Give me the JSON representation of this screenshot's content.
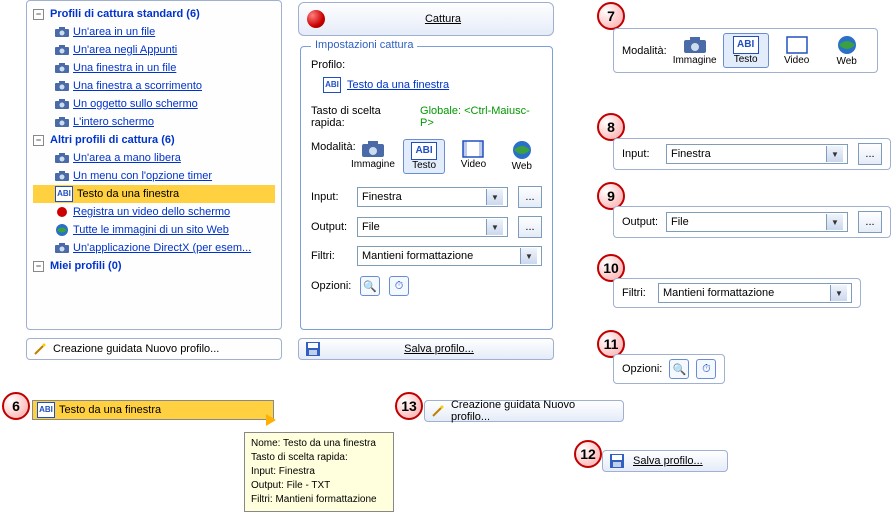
{
  "tree": {
    "header1": "Profili di cattura standard (6)",
    "items1": [
      "Un'area in un file",
      "Un'area negli Appunti",
      "Una finestra in un file",
      "Una finestra a scorrimento",
      "Un oggetto sullo schermo",
      "L'intero schermo"
    ],
    "header2": "Altri profili di cattura (6)",
    "items2": [
      "Un'area a mano libera",
      "Un menu con l'opzione timer",
      "Testo da una finestra",
      "Registra un video dello schermo",
      "Tutte le immagini di un sito Web",
      "Un'applicazione DirectX (per esem..."
    ],
    "header3": "Miei profili (0)"
  },
  "wizard": "Creazione guidata Nuovo profilo...",
  "capture": "Cattura",
  "settings": {
    "title": "Impostazioni cattura",
    "profile_lbl": "Profilo:",
    "profile_name": "Testo da una finestra",
    "hotkey_lbl": "Tasto di scelta rapida:",
    "hotkey_val": "Globale: <Ctrl-Maiusc-P>",
    "mode_lbl": "Modalità:",
    "modes": {
      "img": "Immagine",
      "txt": "Testo",
      "vid": "Video",
      "web": "Web"
    },
    "input_lbl": "Input:",
    "input_val": "Finestra",
    "output_lbl": "Output:",
    "output_val": "File",
    "filter_lbl": "Filtri:",
    "filter_val": "Mantieni formattazione",
    "options_lbl": "Opzioni:"
  },
  "save_profile": "Salva profilo...",
  "callouts": {
    "n6": "6",
    "n7": "7",
    "n8": "8",
    "n9": "9",
    "n10": "10",
    "n11": "11",
    "n12": "12",
    "n13": "13",
    "c6_label": "Testo da una finestra",
    "tip_name": "Nome: Testo da una finestra",
    "tip_hotkey": "Tasto di scelta rapida:",
    "tip_input": "Input: Finestra",
    "tip_output": "Output: File - TXT",
    "tip_filter": "Filtri: Mantieni formattazione",
    "c7_mode_lbl": "Modalità:",
    "c8_input_lbl": "Input:",
    "c8_input_val": "Finestra",
    "c9_output_lbl": "Output:",
    "c9_output_val": "File",
    "c10_filter_lbl": "Filtri:",
    "c10_filter_val": "Mantieni formattazione",
    "c11_options_lbl": "Opzioni:",
    "c12_save": "Salva profilo...",
    "c13_wizard": "Creazione guidata Nuovo profilo...",
    "ellipsis": "..."
  }
}
